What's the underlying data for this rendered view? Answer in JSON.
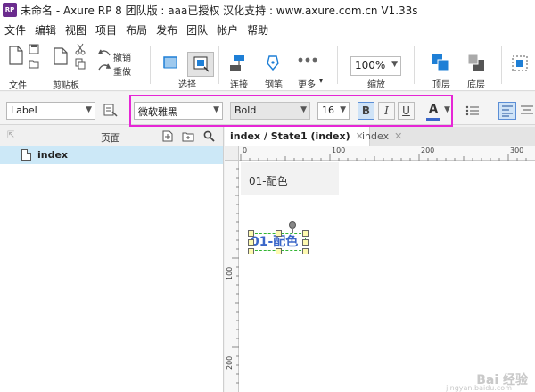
{
  "window": {
    "title": "未命名 - Axure RP 8 团队版 : aaa已授权 汉化支持 : www.axure.com.cn V1.33s",
    "logo_text": "RP"
  },
  "menu": [
    "文件",
    "编辑",
    "视图",
    "项目",
    "布局",
    "发布",
    "团队",
    "帐户",
    "帮助"
  ],
  "toolbar": {
    "file_label": "文件",
    "clipboard_label": "剪贴板",
    "undo_label": "撤销",
    "redo_label": "重做",
    "select_label": "选择",
    "connect_label": "连接",
    "pen_label": "钢笔",
    "more_label": "更多",
    "zoom_value": "100%",
    "zoom_label": "缩放",
    "top_label": "顶层",
    "bottom_label": "底层",
    "accent_color": "#1e7fd6"
  },
  "formatbar": {
    "style_value": "Label",
    "font_family": "微软雅黑",
    "font_weight": "Bold",
    "font_size": "16",
    "bold": "B",
    "italic": "I",
    "underline": "U",
    "font_color_letter": "A",
    "highlight_color": "#e626d6"
  },
  "pages_panel": {
    "title": "页面",
    "items": [
      {
        "label": "index"
      }
    ]
  },
  "tabs": [
    {
      "label": "index / State1 (index)",
      "active": true
    },
    {
      "label": "index",
      "active": false
    }
  ],
  "ruler": {
    "h_ticks": [
      "0",
      "100",
      "200",
      "300"
    ],
    "v_ticks": [
      "100",
      "200"
    ]
  },
  "canvas": {
    "label_text": "01-配色",
    "selected_text": "01-配色",
    "selected_color": "#3b67c9"
  },
  "watermark": {
    "main": "Bai 经验",
    "sub": "jingyan.baidu.com"
  }
}
